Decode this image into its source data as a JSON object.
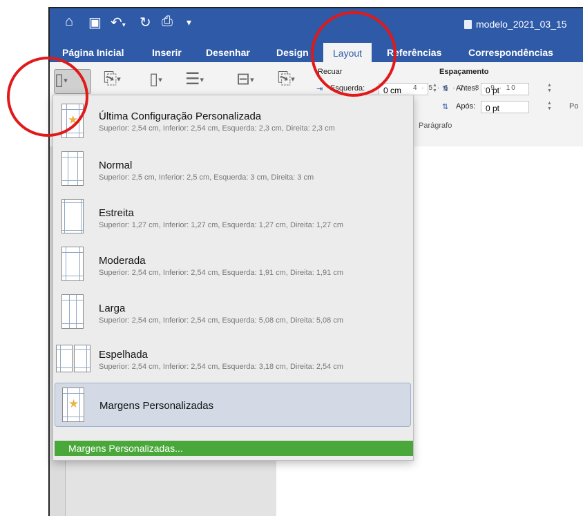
{
  "quick_access": {
    "home_icon": "home-icon",
    "save_icon": "save-icon",
    "undo_icon": "undo-icon",
    "redo_icon": "redo-icon",
    "print_icon": "print-icon",
    "customize_icon": "customize-icon"
  },
  "document": {
    "title": "modelo_2021_03_15"
  },
  "tabs": [
    {
      "label": "Página Inicial"
    },
    {
      "label": "Inserir"
    },
    {
      "label": "Desenhar"
    },
    {
      "label": "Design"
    },
    {
      "label": "Layout"
    },
    {
      "label": "Referências"
    },
    {
      "label": "Correspondências"
    }
  ],
  "ribbon": {
    "indent_label": "Recuar",
    "left_label": "Esquerda:",
    "left_value": "0 cm",
    "spacing_label": "Espaçamento",
    "before_label": "Antes:",
    "before_value": "0 pt",
    "after_label": "Após:",
    "after_value": "0 pt",
    "paragraph_label": "Parágrafo",
    "cut_label": "Po"
  },
  "ruler": {
    "text": "4 · 5 · 6 · 7 · 8 · 9 · 10"
  },
  "margins_menu": {
    "items": [
      {
        "name": "Última Configuração Personalizada",
        "desc": "Superior: 2,54 cm, Inferior: 2,54 cm, Esquerda: 2,3 cm, Direita: 2,3 cm"
      },
      {
        "name": "Normal",
        "desc": "Superior: 2,5 cm, Inferior: 2,5 cm, Esquerda: 3 cm, Direita: 3 cm"
      },
      {
        "name": "Estreita",
        "desc": "Superior: 1,27 cm, Inferior: 1,27 cm, Esquerda: 1,27 cm, Direita: 1,27 cm"
      },
      {
        "name": "Moderada",
        "desc": "Superior: 2,54 cm, Inferior: 2,54 cm, Esquerda: 1,91 cm, Direita: 1,91 cm"
      },
      {
        "name": "Larga",
        "desc": "Superior: 2,54 cm, Inferior: 2,54 cm, Esquerda: 5,08 cm, Direita: 5,08 cm"
      },
      {
        "name": "Espelhada",
        "desc": "Superior: 2,54 cm, Inferior: 2,54 cm, Esquerda: 3,18 cm, Direita: 2,54 cm"
      }
    ],
    "custom_item": "Margens Personalizadas",
    "custom_link": "Margens Personalizadas..."
  },
  "colors": {
    "accent": "#2e5aa8",
    "highlight": "#4aa83a",
    "annotation": "#e01919"
  }
}
